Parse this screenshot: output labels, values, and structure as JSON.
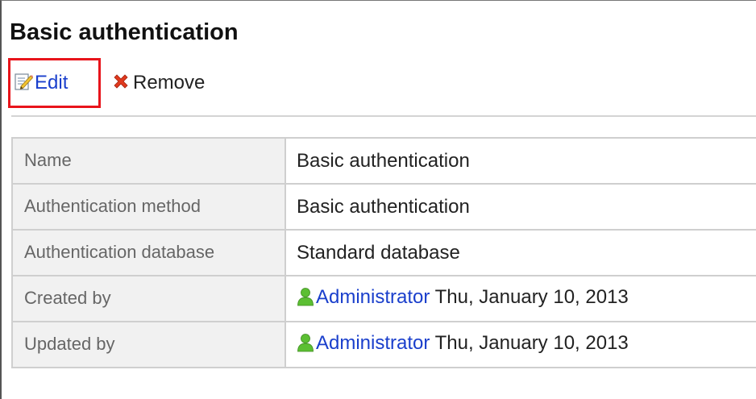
{
  "page": {
    "title": "Basic authentication"
  },
  "toolbar": {
    "edit_label": "Edit",
    "remove_label": "Remove",
    "edit_icon": "edit-pencil-icon",
    "remove_icon": "red-x-icon"
  },
  "details": {
    "rows": [
      {
        "label": "Name",
        "value": "Basic authentication"
      },
      {
        "label": "Authentication method",
        "value": "Basic authentication"
      },
      {
        "label": "Authentication database",
        "value": "Standard database"
      },
      {
        "label": "Created by",
        "user": "Administrator",
        "date": "Thu, January 10, 2013"
      },
      {
        "label": "Updated by",
        "user": "Administrator",
        "date": "Thu, January 10, 2013"
      }
    ]
  },
  "colors": {
    "link": "#1a3fcc",
    "highlight_border": "#e8141b",
    "label_bg": "#f1f1f1",
    "user_icon": "#55b531"
  }
}
